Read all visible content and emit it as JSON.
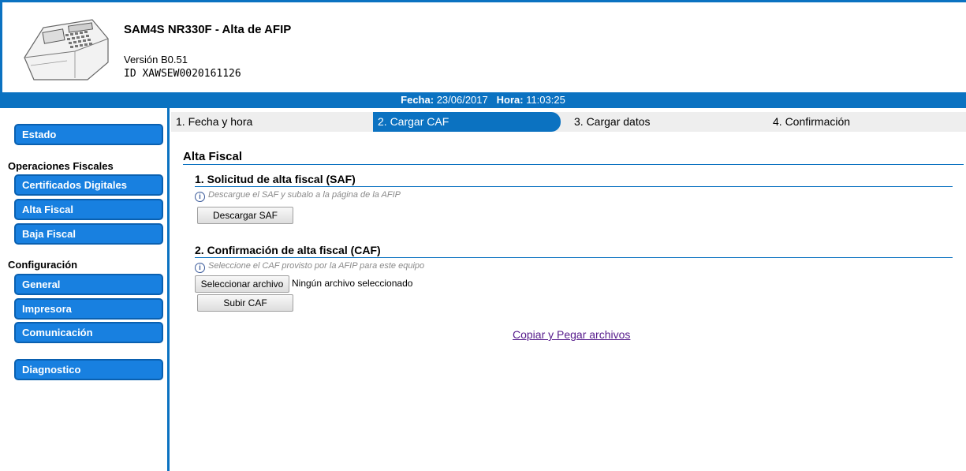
{
  "header": {
    "title": "SAM4S NR330F - Alta de AFIP",
    "version": "Versión B0.51",
    "device_id": "ID XAWSEW0020161126"
  },
  "datebar": {
    "fecha_label": "Fecha:",
    "fecha_value": "23/06/2017",
    "hora_label": "Hora:",
    "hora_value": "11:03:25"
  },
  "sidebar": {
    "estado": "Estado",
    "section_fiscal": "Operaciones Fiscales",
    "certificados": "Certificados Digitales",
    "alta": "Alta Fiscal",
    "baja": "Baja Fiscal",
    "section_config": "Configuración",
    "general": "General",
    "impresora": "Impresora",
    "comunicacion": "Comunicación",
    "diagnostico": "Diagnostico"
  },
  "steps": [
    {
      "label": "1. Fecha y hora"
    },
    {
      "label": "2. Cargar CAF"
    },
    {
      "label": "3. Cargar datos"
    },
    {
      "label": "4. Confirmación"
    }
  ],
  "main": {
    "title": "Alta Fiscal",
    "saf": {
      "heading": "1. Solicitud de alta fiscal (SAF)",
      "hint": "Descargue el SAF y subalo a la página de la AFIP",
      "button": "Descargar SAF"
    },
    "caf": {
      "heading": "2. Confirmación de alta fiscal (CAF)",
      "hint": "Seleccione el CAF provisto por la AFIP para este equipo",
      "file_button": "Seleccionar archivo",
      "file_status": "Ningún archivo seleccionado",
      "upload_button": "Subir CAF"
    },
    "link": "Copiar y Pegar archivos"
  },
  "colors": {
    "accent": "#0b72c1",
    "nav_button": "#1880e0"
  }
}
